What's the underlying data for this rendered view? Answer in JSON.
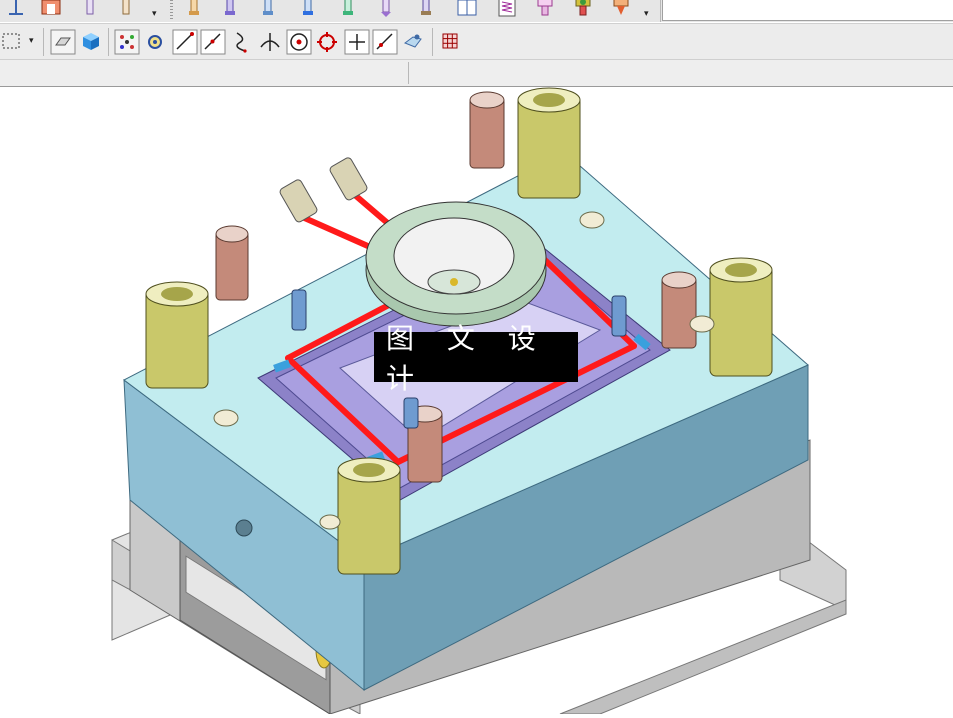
{
  "window": {
    "toolbar_row1_tools": [
      "sketch-point-icon",
      "insert-component-icon",
      "pin-icon",
      "pin-icon",
      "dropdown-arrow",
      "ejector-pin-icon",
      "ejector-pin-icon",
      "ejector-pin-icon",
      "ejector-pin-icon",
      "ejector-pin-icon",
      "ejector-pin-icon",
      "ejector-pin-icon",
      "book-icon",
      "spring-icon",
      "sprue-bushing-icon",
      "cooling-plug-icon",
      "gate-icon",
      "dropdown-arrow"
    ],
    "toolbar_row2_tools": [
      "selection-box-icon",
      "dropdown-arrow",
      "hide-body-icon",
      "shaded-cube-icon",
      "snap-points-icon",
      "snap-gear-icon",
      "line-endpoint-icon",
      "line-midpoint-icon",
      "curve-icon",
      "intersection-icon",
      "circle-center-icon",
      "quadrant-icon",
      "cross-point-icon",
      "point-on-curve-icon",
      "face-point-icon",
      "grid-icon"
    ]
  },
  "viewport": {
    "watermark_text": "图 文 设 计",
    "model": "injection-mold-assembly",
    "colors": {
      "top_plate": "#c2ecef",
      "plate_side_dark": "#6f9fb5",
      "plate_side_light": "#8fbfd4",
      "lower_plates": "#bdbdbd",
      "cavity_insert": "#a08fd0",
      "cooling_lines": "#ff1a1a",
      "guide_bushings": "#c9c86a",
      "screws": "#c48a7a",
      "locating_ring": "#c4ddc8"
    }
  }
}
